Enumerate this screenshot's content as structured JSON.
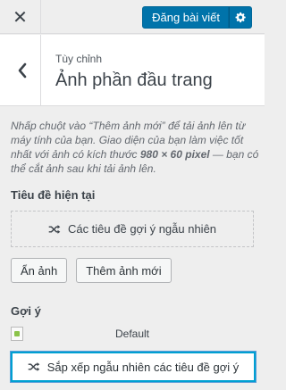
{
  "topbar": {
    "close_icon": "close-icon",
    "publish_label": "Đăng bài viết",
    "settings_icon": "gear-icon"
  },
  "section": {
    "back_icon": "chevron-left-icon",
    "breadcrumb": "Tùy chỉnh",
    "title": "Ảnh phần đầu trang"
  },
  "description": {
    "part1": "Nhấp chuột vào “Thêm ảnh mới” để tải ảnh lên từ máy tính của bạn. Giao diện của bạn làm việc tốt nhất với ảnh có kích thước ",
    "size": "980 × 60 pixel",
    "part2": " — bạn có thể cắt ảnh sau khi tải ảnh lên."
  },
  "current": {
    "label": "Tiêu đề hiện tại",
    "placeholder_text": "Các tiêu đề gợi ý ngẫu nhiên",
    "placeholder_icon": "shuffle-icon"
  },
  "buttons": {
    "hide_label": "Ẩn ảnh",
    "add_label": "Thêm ảnh mới"
  },
  "suggestions": {
    "label": "Gợi ý",
    "default_label": "Default",
    "shuffle_label": "Sắp xếp ngẫu nhiên các tiêu đề gợi ý",
    "shuffle_icon": "shuffle-icon"
  },
  "colors": {
    "primary": "#0073aa",
    "focus": "#00a0d2",
    "background": "#eeeeee"
  }
}
